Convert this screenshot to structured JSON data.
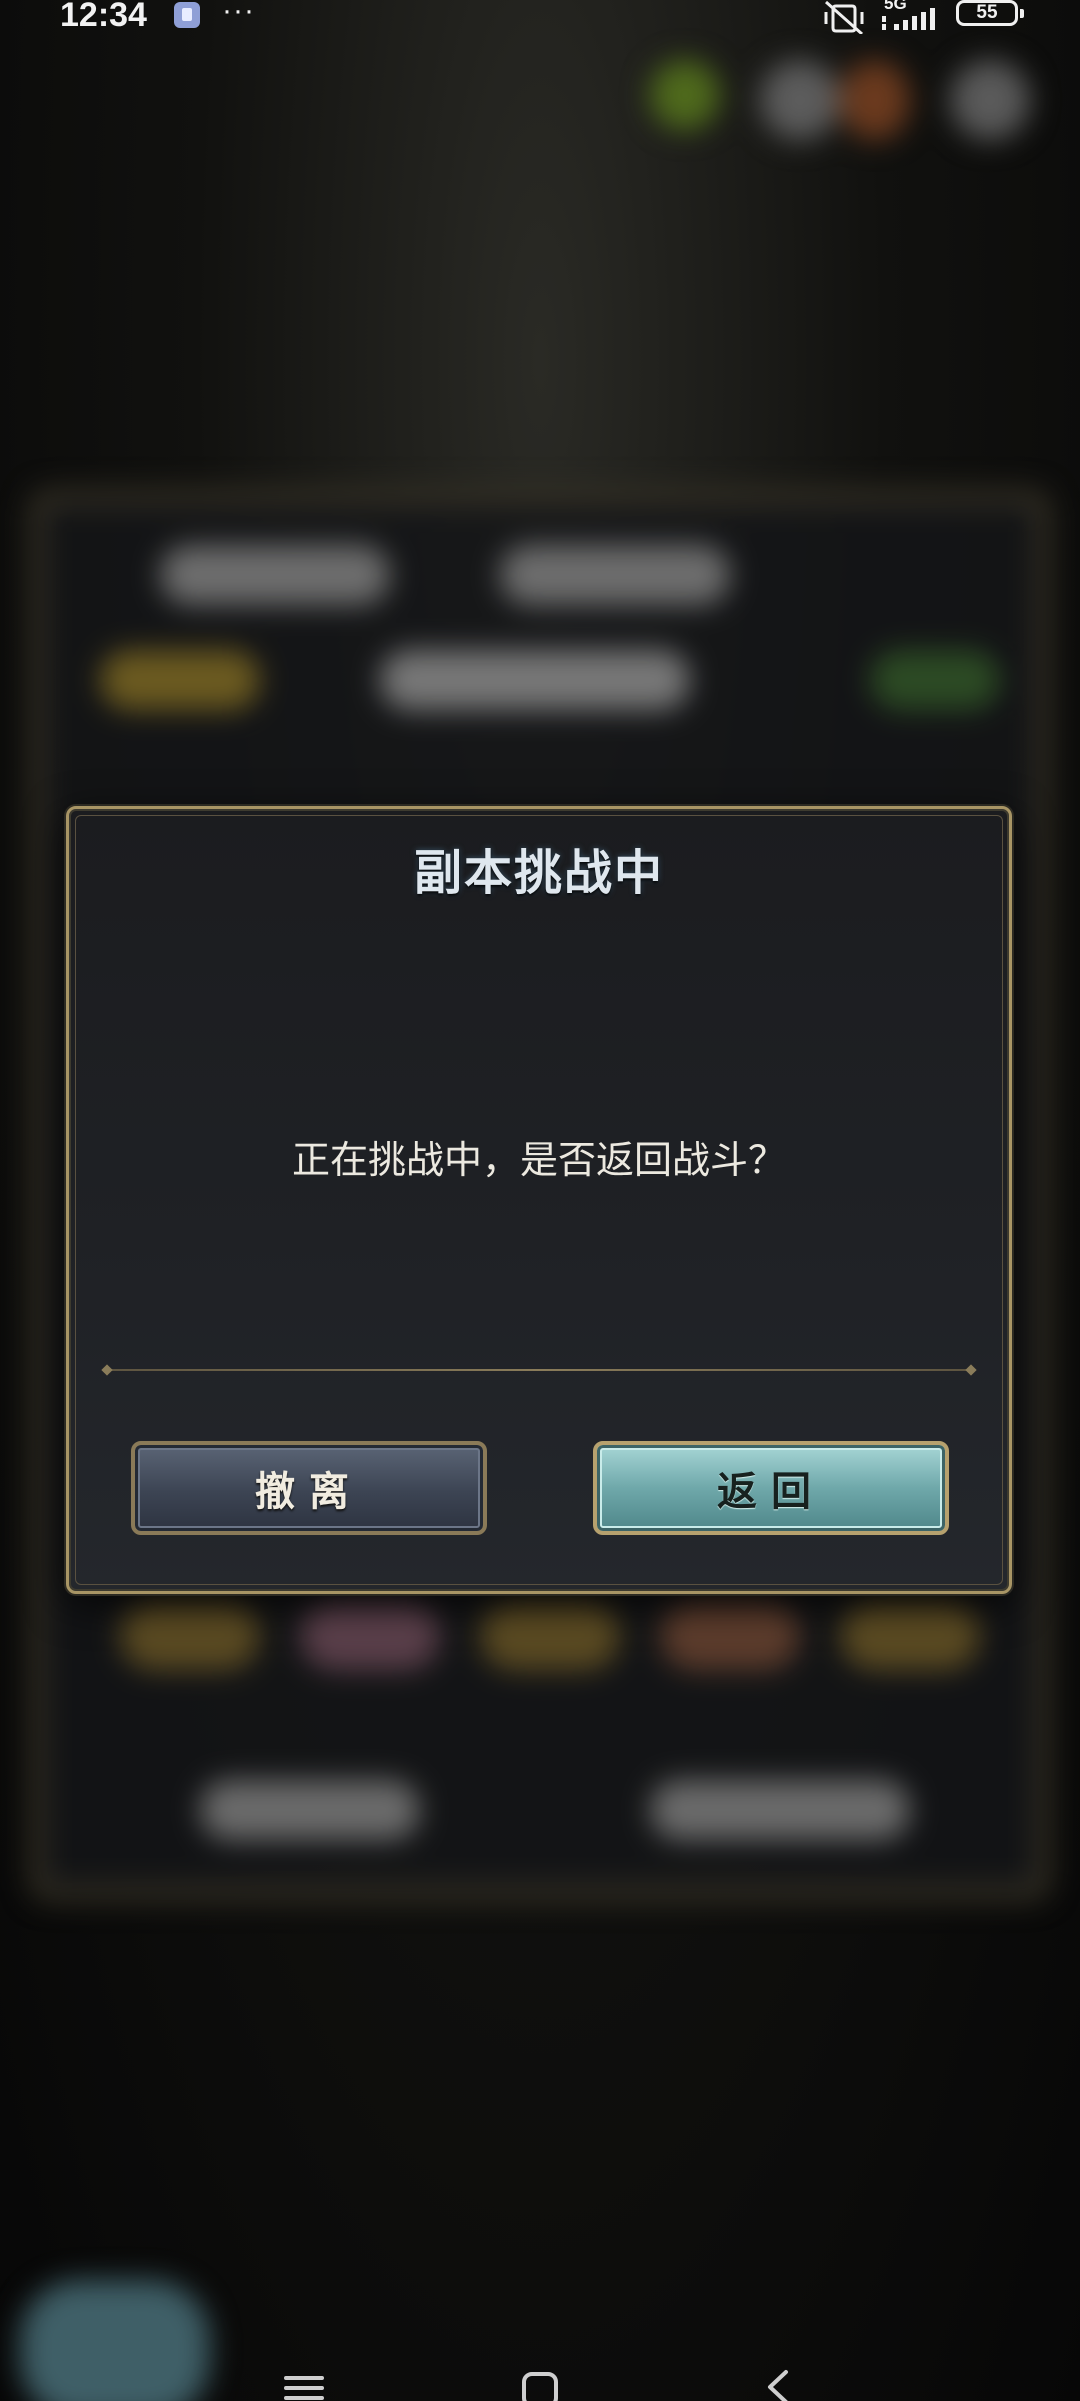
{
  "status_bar": {
    "time": "12:34",
    "more_indicator": "···",
    "network_type": "5G",
    "battery_level": "55"
  },
  "dialog": {
    "title": "副本挑战中",
    "message": "正在挑战中，是否返回战斗？",
    "withdraw_label": "撤离",
    "return_label": "返回"
  },
  "icons": {
    "status_app": "notification-app-icon",
    "mute": "vibrate-off-icon",
    "signal": "signal-bars-icon",
    "nav_menu": "menu-icon",
    "nav_home": "home-icon",
    "nav_back": "back-icon"
  },
  "colors": {
    "dialog_border": "#a89565",
    "dialog_bg": "#1f2125",
    "withdraw_button": "#3c4453",
    "return_button": "#6fa8aa",
    "title_text": "#dfe7ee"
  }
}
